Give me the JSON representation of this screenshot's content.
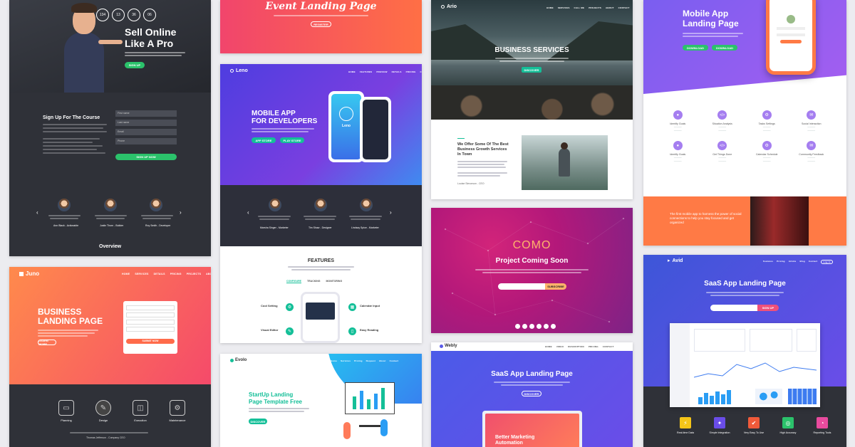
{
  "colors": {
    "bg": "#ececf0",
    "dark": "#2d2f36",
    "orange": "#ff6b4a",
    "purple": "#6a4de8",
    "green": "#2bc26b"
  },
  "card1": {
    "stats": [
      "134",
      "13",
      "36",
      "06"
    ],
    "headline1": "Sell Online",
    "headline2": "Like A Pro",
    "cta": "SIGN UP",
    "form_title": "Sign Up For The Course",
    "fields": [
      "First name",
      "Last name",
      "Email",
      "Phone"
    ],
    "submit": "SIGN UP NOW",
    "testimonials": [
      {
        "name": "Ann Black",
        "role": "Actionable"
      },
      {
        "name": "Justin Thorn",
        "role": "Builder"
      },
      {
        "name": "Roy Smith",
        "role": "Developer"
      }
    ],
    "overview": "Overview"
  },
  "card2": {
    "logo": "Juno",
    "title1": "BUSINESS",
    "title2": "LANDING PAGE",
    "button": "LEARN MORE",
    "form_button": "SUBMIT NOW",
    "steps": [
      "Planning",
      "Design",
      "Execution",
      "Maintenance"
    ],
    "author": "Thomas Jefferson - Company CEO"
  },
  "card3": {
    "title": "Event Landing Page",
    "button": "REGISTER"
  },
  "card4": {
    "logo": "Leno",
    "title1": "MOBILE APP",
    "title2": "FOR DEVELOPERS",
    "btn1": "APP STORE",
    "btn2": "PLAY STORE",
    "phone_logo": "Leno",
    "testimonials": [
      {
        "name": "Marsha Singer",
        "role": "Marketer"
      },
      {
        "name": "Tim Shaw",
        "role": "Designer"
      },
      {
        "name": "Lindsay Spice",
        "role": "Marketer"
      }
    ],
    "features_title": "FEATURES",
    "tabs": [
      "CONFIGURE",
      "TRACKING",
      "MONITORING"
    ],
    "features": [
      "Cool Setting",
      "Calendar Input",
      "Visual Editor",
      "Easy Reading"
    ]
  },
  "card5": {
    "logo": "Evolo",
    "title1": "StartUp Landing",
    "title2": "Page Template Free",
    "button": "DISCOVER"
  },
  "card6": {
    "logo": "Ario",
    "title": "BUSINESS SERVICES",
    "button": "DISCOVER",
    "subtitle": "We Offer Some Of The Best Business Growth Services In Town",
    "author": "Louise Simonson - CEO"
  },
  "card7": {
    "logo": "COMO",
    "title": "Project Coming Soon",
    "button": "SUBSCRIBE"
  },
  "card8": {
    "logo": "Webly",
    "title": "SaaS App Landing Page",
    "button": "DISCOVER",
    "laptop_text1": "Better Marketing",
    "laptop_text2": "Automation"
  },
  "card9": {
    "title1": "Mobile App",
    "title2": "Landing Page",
    "btn1": "DOWNLOAD",
    "btn2": "DOWNLOAD",
    "features": [
      "Identify Goals",
      "Situation Analysis",
      "Tasks Settings",
      "Social Interaction",
      "Identify Goals",
      "Get Things Done",
      "Calendar Schedule",
      "Community Feedback"
    ],
    "banner": "The first mobile app to harness the power of social connections to help you stay focused and get organized"
  },
  "card10": {
    "logo": "Avid",
    "title": "SaaS App Landing Page",
    "button": "SIGN UP",
    "features": [
      "Real-time Data",
      "Simple Integration",
      "Very Easy To Use",
      "High Accuracy",
      "Reporting Tools"
    ]
  }
}
